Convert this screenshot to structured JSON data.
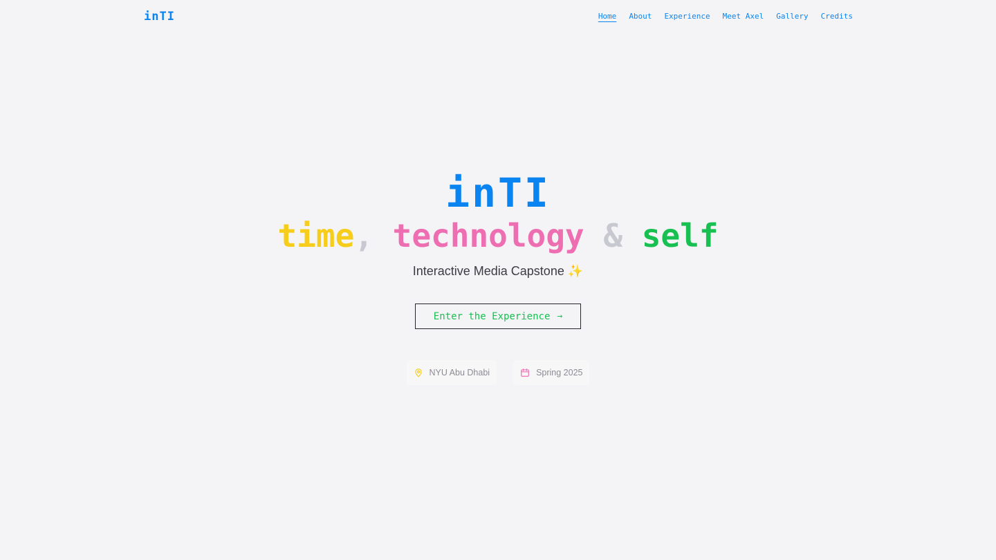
{
  "colors": {
    "blue": "#0a84f0",
    "yellow": "#f6cd1a",
    "pink": "#ee6eb2",
    "green": "#17c050",
    "gray": "#c8c8d0"
  },
  "nav": {
    "logo": "inTI",
    "links": [
      "Home",
      "About",
      "Experience",
      "Meet Axel",
      "Gallery",
      "Credits"
    ],
    "active": "Home"
  },
  "hero": {
    "logo": "inTI",
    "tagline": {
      "word1": "time",
      "sep1": ",",
      "word2": "technology",
      "sep2": "&",
      "word3": "self"
    },
    "subtitle": "Interactive Media Capstone ✨",
    "cta_label": "Enter the Experience",
    "cta_icon": "arrow-right-icon"
  },
  "badges": [
    {
      "icon": "map-pin-icon",
      "label": "NYU Abu Dhabi"
    },
    {
      "icon": "calendar-icon",
      "label": "Spring 2025"
    }
  ]
}
